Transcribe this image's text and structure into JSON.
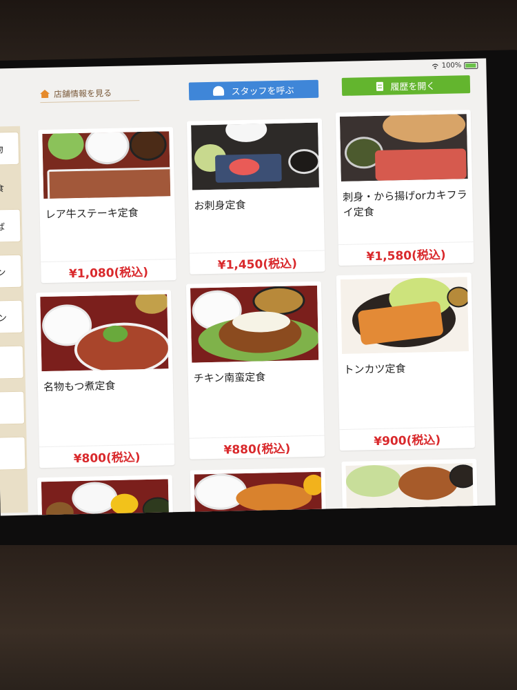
{
  "status": {
    "battery": "100%"
  },
  "header": {
    "store_info": "店舗情報を見る",
    "call_staff": "スタッフを呼ぶ",
    "history": "履歴を開く"
  },
  "sidebar": {
    "items": [
      {
        "label": "物"
      },
      {
        "label": "食"
      },
      {
        "label": "ば"
      },
      {
        "label": "ン"
      },
      {
        "label": "ン"
      },
      {
        "label": ""
      },
      {
        "label": ""
      },
      {
        "label": ""
      }
    ]
  },
  "menu": [
    {
      "name": "レア牛ステーキ定食",
      "price": "¥1,080(税込)"
    },
    {
      "name": "お刺身定食",
      "price": "¥1,450(税込)"
    },
    {
      "name": "刺身・から揚げorカキフライ定食",
      "price": "¥1,580(税込)"
    },
    {
      "name": "名物もつ煮定食",
      "price": "¥800(税込)"
    },
    {
      "name": "チキン南蛮定食",
      "price": "¥880(税込)"
    },
    {
      "name": "トンカツ定食",
      "price": "¥900(税込)"
    },
    {
      "name": "",
      "price": ""
    },
    {
      "name": "",
      "price": ""
    },
    {
      "name": "",
      "price": ""
    }
  ]
}
